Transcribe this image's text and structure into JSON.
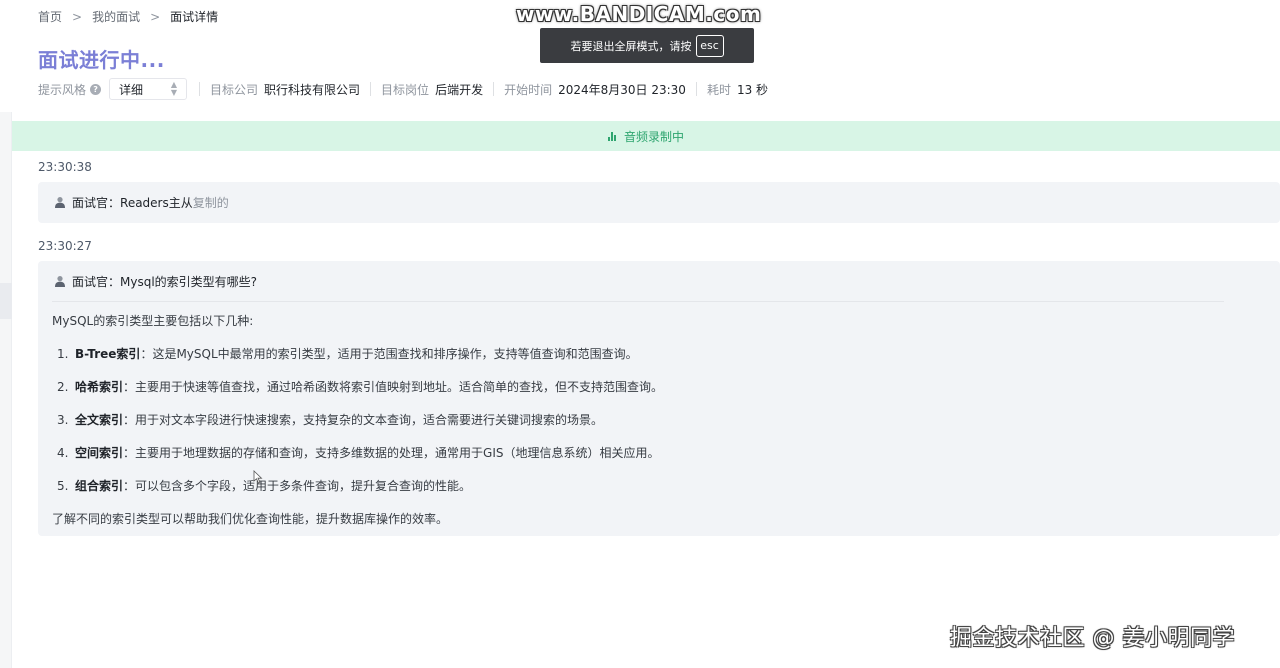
{
  "breadcrumb": {
    "home": "首页",
    "my_interviews": "我的面试",
    "current": "面试详情",
    "separator": ">"
  },
  "page": {
    "title": "面试进行中..."
  },
  "meta": {
    "hint_style_label": "提示风格",
    "hint_style_value": "详细",
    "company_label": "目标公司",
    "company_value": "职行科技有限公司",
    "position_label": "目标岗位",
    "position_value": "后端开发",
    "start_label": "开始时间",
    "start_value": "2024年8月30日 23:30",
    "duration_label": "耗时",
    "duration_value": "13 秒"
  },
  "recording": {
    "text": "音频录制中"
  },
  "messages": [
    {
      "time": "23:30:38",
      "prefix": "面试官：",
      "question": "Readers主从",
      "suffix": "复制的"
    },
    {
      "time": "23:30:27",
      "prefix": "面试官：",
      "question": "Mysql的索引类型有哪些?",
      "answer": {
        "intro": "MySQL的索引类型主要包括以下几种:",
        "items": [
          {
            "num": "1.",
            "term": "B-Tree索引",
            "text": "：这是MySQL中最常用的索引类型，适用于范围查找和排序操作，支持等值查询和范围查询。"
          },
          {
            "num": "2.",
            "term": "哈希索引",
            "text": "：主要用于快速等值查找，通过哈希函数将索引值映射到地址。适合简单的查找，但不支持范围查询。"
          },
          {
            "num": "3.",
            "term": "全文索引",
            "text": "：用于对文本字段进行快速搜索，支持复杂的文本查询，适合需要进行关键词搜索的场景。"
          },
          {
            "num": "4.",
            "term": "空间索引",
            "text": "：主要用于地理数据的存储和查询，支持多维数据的处理，通常用于GIS（地理信息系统）相关应用。"
          },
          {
            "num": "5.",
            "term": "组合索引",
            "text": "：可以包含多个字段，适用于多条件查询，提升复合查询的性能。"
          }
        ],
        "outro": "了解不同的索引类型可以帮助我们优化查询性能，提升数据库操作的效率。"
      }
    }
  ],
  "overlay": {
    "bandicam": "www.BANDICAM.com",
    "fullscreen_hint": "若要退出全屏模式，请按",
    "esc_key": "esc",
    "site_watermark": "掘金技术社区 @ 姜小明同学"
  },
  "colors": {
    "title": "#7b7fd6",
    "recording_bg": "#d8f5e6",
    "recording_text": "#2ea56f",
    "card_bg": "#f2f4f7"
  },
  "icons": {
    "help": "question-circle-icon",
    "select": "chevron-updown-icon",
    "recording": "audio-bars-icon",
    "speaker": "person-icon"
  }
}
